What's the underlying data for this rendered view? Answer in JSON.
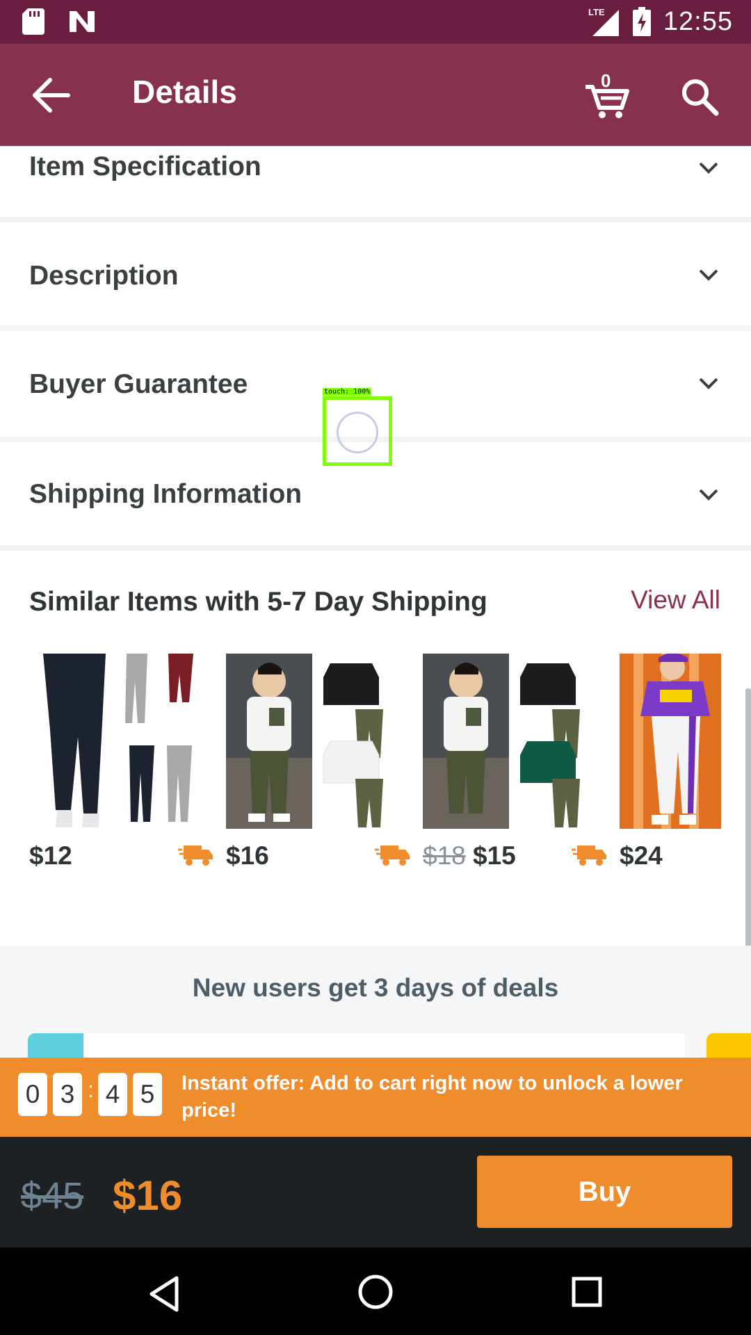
{
  "status_bar": {
    "time": "12:55",
    "network": "LTE"
  },
  "app_bar": {
    "title": "Details",
    "cart_count": "0"
  },
  "sections": [
    {
      "label": "Item Specification"
    },
    {
      "label": "Description"
    },
    {
      "label": "Buyer Guarantee"
    },
    {
      "label": "Shipping Information"
    }
  ],
  "similar": {
    "title": "Similar Items with 5-7 Day Shipping",
    "view_all": "View All",
    "items": [
      {
        "price": "$12",
        "image": "pants-image"
      },
      {
        "price": "$16",
        "image": "boy-outfit-image"
      },
      {
        "old_price": "$18",
        "price": "$15",
        "image": "boy-outfit-variants-image"
      },
      {
        "price": "$24",
        "image": "girl-outfit-image"
      }
    ]
  },
  "promo": {
    "text": "New users get 3 days of deals"
  },
  "offer": {
    "timer": [
      "0",
      "3",
      "4",
      "5"
    ],
    "separator": ":",
    "text": "Instant offer: Add to cart right now to unlock a lower price!"
  },
  "buy_bar": {
    "old_price": "$45",
    "price": "$16",
    "buy_label": "Buy"
  },
  "overlay": {
    "touch_label": "touch: 100%"
  },
  "colors": {
    "app_bar": "#87304f",
    "status_bar": "#6a1e40",
    "accent": "#ef8c2b",
    "buy_bar": "#1e2124"
  }
}
